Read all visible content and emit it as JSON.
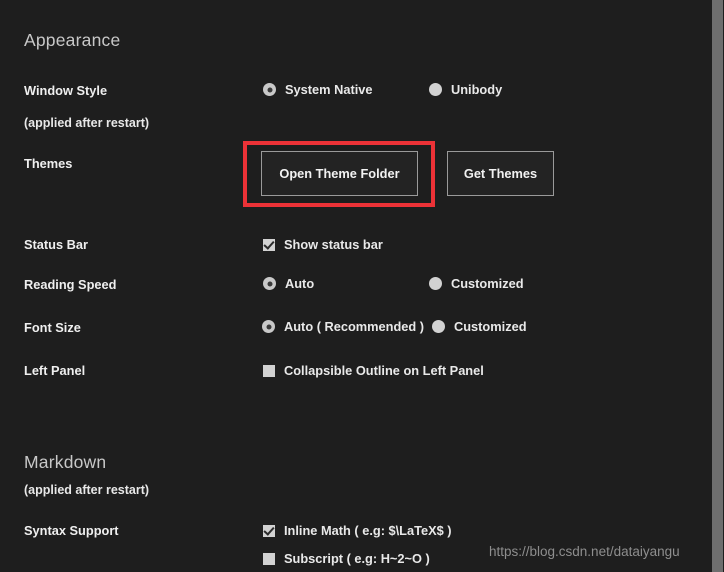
{
  "sections": {
    "appearance": {
      "title": "Appearance",
      "rows": {
        "window_style": {
          "label": "Window Style",
          "note": "(applied after restart)",
          "options": [
            {
              "label": "System Native",
              "selected": true
            },
            {
              "label": "Unibody",
              "selected": false
            }
          ]
        },
        "themes": {
          "label": "Themes",
          "buttons": [
            {
              "label": "Open Theme Folder",
              "highlighted": true
            },
            {
              "label": "Get Themes",
              "highlighted": false
            }
          ]
        },
        "status_bar": {
          "label": "Status Bar",
          "options": [
            {
              "label": "Show status bar",
              "checked": true
            }
          ]
        },
        "reading_speed": {
          "label": "Reading Speed",
          "options": [
            {
              "label": "Auto",
              "selected": true
            },
            {
              "label": "Customized",
              "selected": false
            }
          ]
        },
        "font_size": {
          "label": "Font Size",
          "options": [
            {
              "label": "Auto ( Recommended )",
              "selected": true
            },
            {
              "label": "Customized",
              "selected": false
            }
          ]
        },
        "left_panel": {
          "label": "Left Panel",
          "options": [
            {
              "label": "Collapsible Outline on Left Panel",
              "checked": false
            }
          ]
        }
      }
    },
    "markdown": {
      "title": "Markdown",
      "note": "(applied after restart)",
      "rows": {
        "syntax_support": {
          "label": "Syntax Support",
          "options": [
            {
              "label": "Inline Math ( e.g: $\\LaTeX$ )",
              "checked": true
            },
            {
              "label": "Subscript ( e.g: H~2~O )",
              "checked": false
            }
          ]
        }
      }
    }
  },
  "annotation": {
    "highlight_color": "#ec3237"
  },
  "watermark": {
    "text": "https://blog.csdn.net/dataiyangu"
  },
  "colors": {
    "background": "#1e1e1e",
    "text": "#e9e9e9",
    "heading": "#c8c8c8",
    "control": "#d2d2d2",
    "button_border": "#9a9a9a",
    "scrollbar": "#6e6e6e"
  }
}
